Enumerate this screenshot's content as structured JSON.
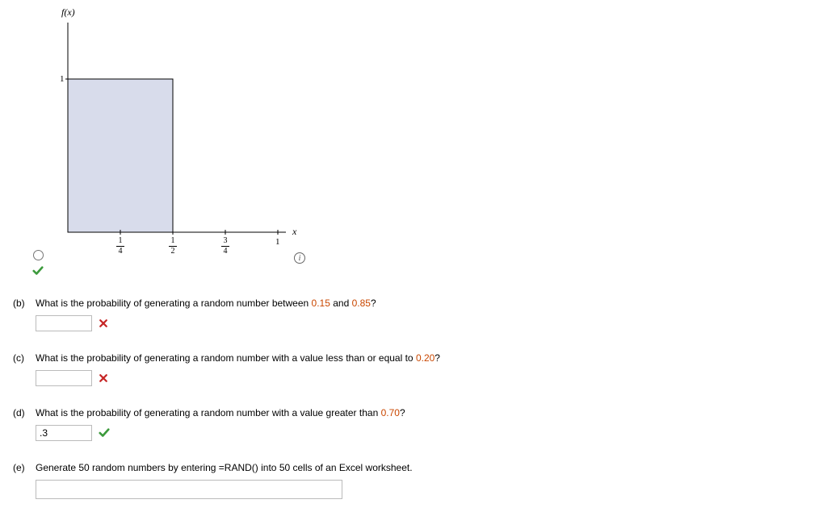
{
  "chart_data": {
    "type": "area",
    "title": "",
    "xlabel": "x",
    "ylabel": "f(x)",
    "xlim": [
      0,
      1
    ],
    "ylim": [
      0,
      1
    ],
    "x_ticks": [
      {
        "num": "1",
        "den": "4",
        "value": 0.25
      },
      {
        "num": "1",
        "den": "2",
        "value": 0.5
      },
      {
        "num": "3",
        "den": "4",
        "value": 0.75
      },
      {
        "label": "1",
        "value": 1.0
      }
    ],
    "y_ticks": [
      {
        "label": "1",
        "value": 1.0
      }
    ],
    "region": {
      "x0": 0,
      "x1": 0.5,
      "y": 1.0
    }
  },
  "checkmark_alt": "correct",
  "questions": {
    "b": {
      "label": "(b)",
      "text_pre": "What is the probability of generating a random number between ",
      "v1": "0.15",
      "mid": " and ",
      "v2": "0.85",
      "text_post": "?",
      "answer": "",
      "status": "incorrect"
    },
    "c": {
      "label": "(c)",
      "text_pre": "What is the probability of generating a random number with a value less than or equal to ",
      "v1": "0.20",
      "text_post": "?",
      "answer": "",
      "status": "incorrect"
    },
    "d": {
      "label": "(d)",
      "text_pre": "What is the probability of generating a random number with a value greater than ",
      "v1": "0.70",
      "text_post": "?",
      "answer": ".3",
      "status": "correct"
    },
    "e": {
      "label": "(e)",
      "text": "Generate 50 random numbers by entering =RAND() into 50 cells of an Excel worksheet.",
      "answer": ""
    }
  }
}
